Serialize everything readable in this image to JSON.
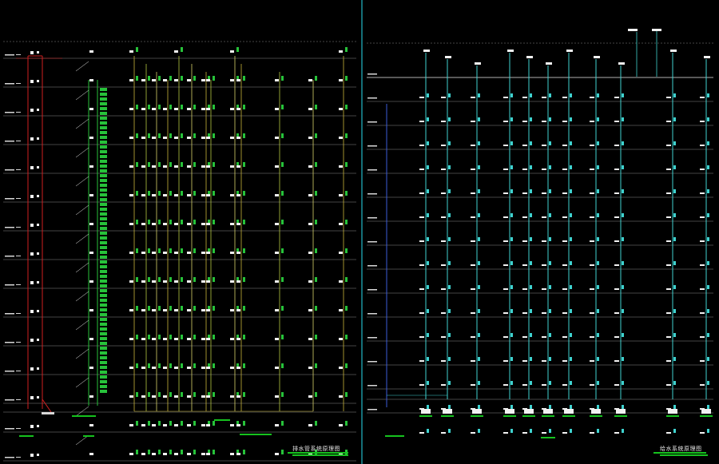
{
  "drawing": {
    "background": "#000000",
    "divider_color": "#22b8c8",
    "colors": {
      "grid": "#8a8a8a",
      "floor_line": "#d8d8d8",
      "riser_red": "#d12020",
      "riser_green": "#27c23a",
      "riser_yellow": "#c8b43a",
      "riser_cyan": "#3fd2cf",
      "riser_blue": "#3b5bd9",
      "fixture_white": "#f2f2f2",
      "label_green": "#16c21e"
    }
  },
  "left_sheet": {
    "name": "drainage-riser-diagram",
    "title": "排水管系统原理图",
    "floor_count": 15
  },
  "right_sheet": {
    "name": "water-supply-riser-diagram",
    "title": "给水系统原理图",
    "floor_count": 15
  }
}
